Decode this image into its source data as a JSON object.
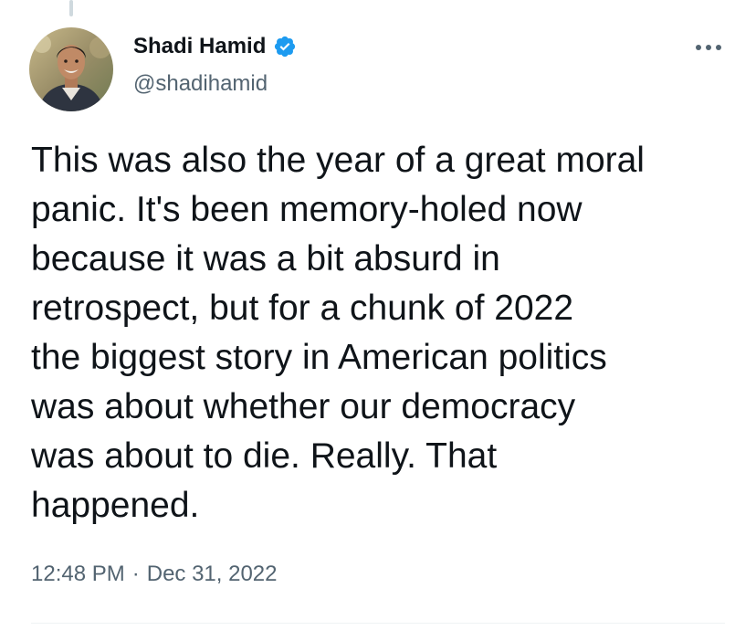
{
  "author": {
    "display_name": "Shadi Hamid",
    "handle": "@shadihamid",
    "verified_icon": "verified-badge-icon",
    "avatar_icon": "profile-photo"
  },
  "tweet": {
    "text": "This was also the year of a great moral\npanic. It's been memory-holed now\nbecause it was a bit absurd in\nretrospect, but for a chunk of 2022\nthe biggest story in American politics\nwas about whether our democracy\nwas about to die. Really. That\nhappened.",
    "time": "12:48 PM",
    "separator": "·",
    "date": "Dec 31, 2022"
  },
  "icons": {
    "more": "more-horizontal-icon"
  },
  "colors": {
    "text_primary": "#0f1419",
    "text_secondary": "#536471",
    "verified_blue": "#1d9bf0",
    "divider": "#eff3f4"
  }
}
